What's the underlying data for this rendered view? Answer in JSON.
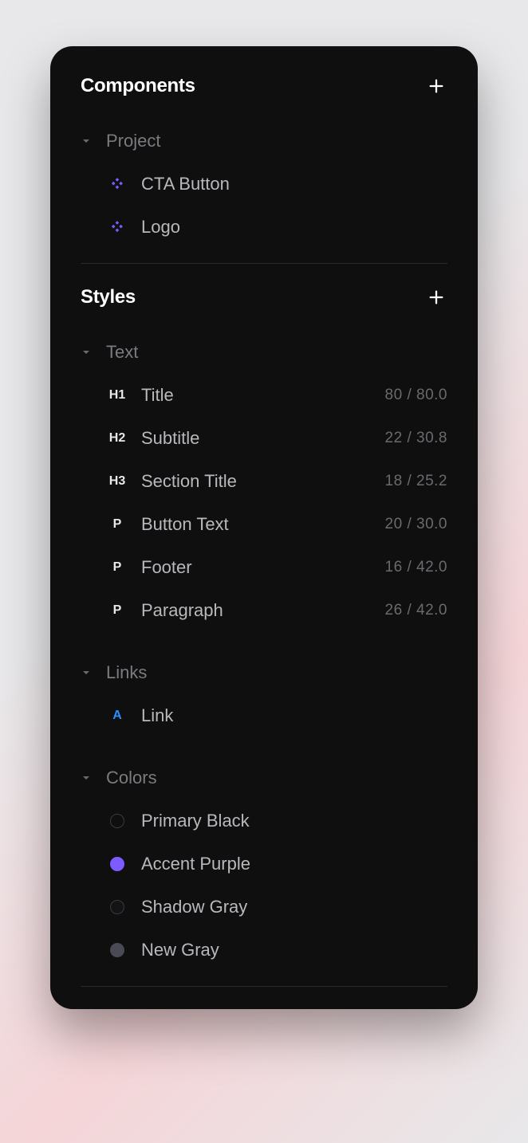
{
  "components": {
    "title": "Components",
    "groups": [
      {
        "label": "Project",
        "items": [
          {
            "label": "CTA Button"
          },
          {
            "label": "Logo"
          }
        ]
      }
    ]
  },
  "styles": {
    "title": "Styles",
    "text_group": {
      "label": "Text",
      "items": [
        {
          "tag": "H1",
          "label": "Title",
          "metrics": "80 / 80.0"
        },
        {
          "tag": "H2",
          "label": "Subtitle",
          "metrics": "22 / 30.8"
        },
        {
          "tag": "H3",
          "label": "Section Title",
          "metrics": "18 / 25.2"
        },
        {
          "tag": "P",
          "label": "Button Text",
          "metrics": "20 / 30.0"
        },
        {
          "tag": "P",
          "label": "Footer",
          "metrics": "16 / 42.0"
        },
        {
          "tag": "P",
          "label": "Paragraph",
          "metrics": "26 / 42.0"
        }
      ]
    },
    "links_group": {
      "label": "Links",
      "items": [
        {
          "tag": "A",
          "label": "Link"
        }
      ]
    },
    "colors_group": {
      "label": "Colors",
      "items": [
        {
          "label": "Primary Black",
          "hex": "#0f0f10"
        },
        {
          "label": "Accent Purple",
          "hex": "#7c5cff"
        },
        {
          "label": "Shadow Gray",
          "hex": "#141417"
        },
        {
          "label": "New Gray",
          "hex": "#4a4a55"
        }
      ]
    }
  }
}
